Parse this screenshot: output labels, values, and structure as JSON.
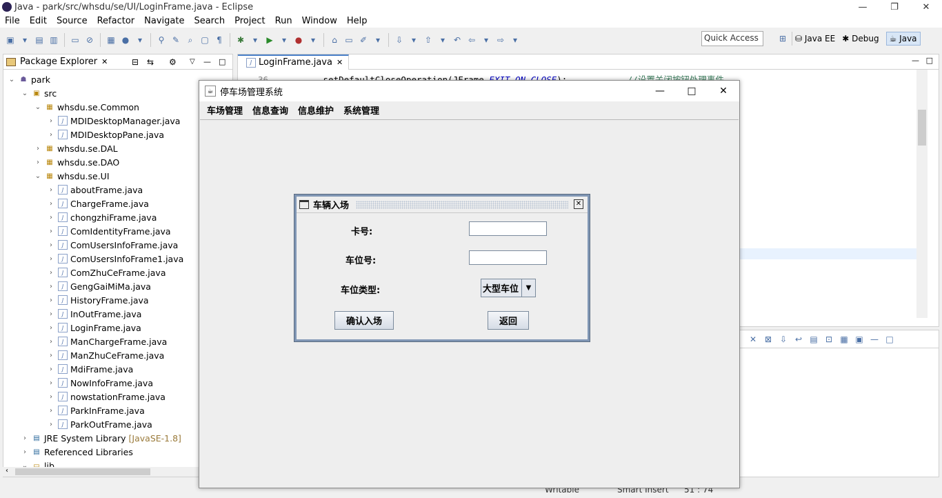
{
  "window": {
    "title": "Java - park/src/whsdu/se/UI/LoginFrame.java - Eclipse"
  },
  "menu": [
    "File",
    "Edit",
    "Source",
    "Refactor",
    "Navigate",
    "Search",
    "Project",
    "Run",
    "Window",
    "Help"
  ],
  "toolbar": {
    "quick_access": "Quick Access",
    "perspectives": [
      "Java EE",
      "Debug",
      "Java"
    ]
  },
  "package_explorer": {
    "tab_label": "Package Explorer",
    "tree": [
      {
        "label": "park",
        "level": 0,
        "expanded": true,
        "icon": "project-icon"
      },
      {
        "label": "src",
        "level": 1,
        "expanded": true,
        "icon": "source-folder-icon"
      },
      {
        "label": "whsdu.se.Common",
        "level": 2,
        "expanded": true,
        "icon": "package-icon"
      },
      {
        "label": "MDIDesktopManager.java",
        "level": 3,
        "icon": "java-file-icon"
      },
      {
        "label": "MDIDesktopPane.java",
        "level": 3,
        "icon": "java-file-icon"
      },
      {
        "label": "whsdu.se.DAL",
        "level": 2,
        "expanded": false,
        "icon": "package-icon"
      },
      {
        "label": "whsdu.se.DAO",
        "level": 2,
        "expanded": false,
        "icon": "package-icon"
      },
      {
        "label": "whsdu.se.UI",
        "level": 2,
        "expanded": true,
        "icon": "package-icon"
      },
      {
        "label": "aboutFrame.java",
        "level": 3,
        "icon": "java-file-icon"
      },
      {
        "label": "ChargeFrame.java",
        "level": 3,
        "icon": "java-file-icon"
      },
      {
        "label": "chongzhiFrame.java",
        "level": 3,
        "icon": "java-file-icon"
      },
      {
        "label": "ComIdentityFrame.java",
        "level": 3,
        "icon": "java-file-icon"
      },
      {
        "label": "ComUsersInfoFrame.java",
        "level": 3,
        "icon": "java-file-icon"
      },
      {
        "label": "ComUsersInfoFrame1.java",
        "level": 3,
        "icon": "java-file-icon"
      },
      {
        "label": "ComZhuCeFrame.java",
        "level": 3,
        "icon": "java-file-icon"
      },
      {
        "label": "GengGaiMiMa.java",
        "level": 3,
        "icon": "java-file-icon"
      },
      {
        "label": "HistoryFrame.java",
        "level": 3,
        "icon": "java-file-icon"
      },
      {
        "label": "InOutFrame.java",
        "level": 3,
        "icon": "java-file-icon"
      },
      {
        "label": "LoginFrame.java",
        "level": 3,
        "icon": "java-file-icon"
      },
      {
        "label": "ManChargeFrame.java",
        "level": 3,
        "icon": "java-file-icon"
      },
      {
        "label": "ManZhuCeFrame.java",
        "level": 3,
        "icon": "java-file-icon"
      },
      {
        "label": "MdiFrame.java",
        "level": 3,
        "icon": "java-file-icon"
      },
      {
        "label": "NowInfoFrame.java",
        "level": 3,
        "icon": "java-file-icon"
      },
      {
        "label": "nowstationFrame.java",
        "level": 3,
        "icon": "java-file-icon"
      },
      {
        "label": "ParkInFrame.java",
        "level": 3,
        "icon": "java-file-icon"
      },
      {
        "label": "ParkOutFrame.java",
        "level": 3,
        "icon": "java-file-icon"
      },
      {
        "label": "JRE System Library",
        "suffix": "[JavaSE-1.8]",
        "level": 1,
        "expanded": false,
        "icon": "library-icon"
      },
      {
        "label": "Referenced Libraries",
        "level": 1,
        "expanded": false,
        "icon": "library-icon"
      },
      {
        "label": "lib",
        "level": 1,
        "expanded": true,
        "icon": "folder-icon"
      }
    ]
  },
  "editor": {
    "tab_label": "LoginFrame.java",
    "line_number": "36",
    "code_prefix": "setDefaultCloseOperation(JFrame.",
    "code_const": "EXIT_ON_CLOSE",
    "code_suffix": ");",
    "code_comment": "//设置关闭按钮处理事件"
  },
  "status": {
    "writable": "Writable",
    "insert_mode": "Smart Insert",
    "position": "51 : 74"
  },
  "app_window": {
    "title": "停车场管理系统",
    "menu": [
      "车场管理",
      "信息查询",
      "信息维护",
      "系统管理"
    ]
  },
  "dialog": {
    "title": "车辆入场",
    "card_label": "卡号:",
    "slot_label": "车位号:",
    "type_label": "车位类型:",
    "type_value": "大型车位",
    "confirm_label": "确认入场",
    "back_label": "返回"
  }
}
